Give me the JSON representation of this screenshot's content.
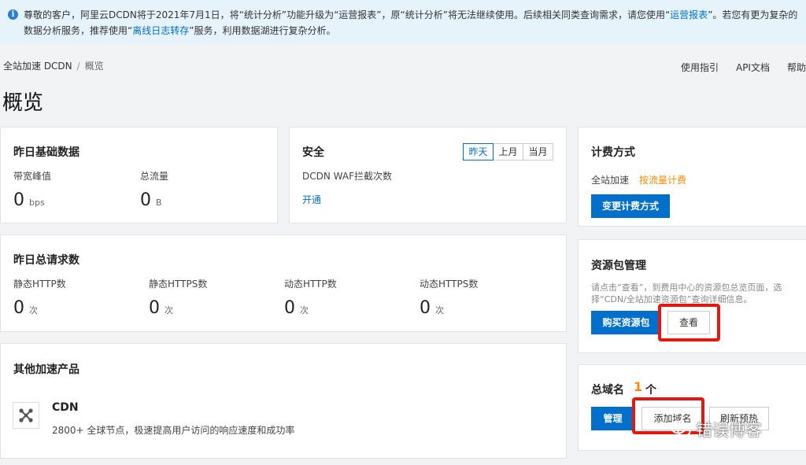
{
  "notice": {
    "part1": "尊敬的客户，阿里云DCDN将于2021年7月1日，将“统计分析”功能升级为“运营报表”，原“统计分析”将无法继续使用。后续相关同类查询需求，请您使用“",
    "link1": "运营报表",
    "part2": "”。若您有更为复杂的数据分析服务，推荐使用“",
    "link2": "离线日志转存",
    "part3": "”服务，利用数据湖进行复杂分析。"
  },
  "breadcrumb": {
    "root": "全站加速 DCDN",
    "sep": "/",
    "current": "概览"
  },
  "toplinks": {
    "guide": "使用指引",
    "api": "API文档",
    "help": "帮助"
  },
  "page_title": "概览",
  "basic": {
    "title": "昨日基础数据",
    "bandwidth_label": "带宽峰值",
    "bandwidth_value": "0",
    "bandwidth_unit": "bps",
    "traffic_label": "总流量",
    "traffic_value": "0",
    "traffic_unit": "B"
  },
  "security": {
    "title": "安全",
    "tabs": [
      "昨天",
      "上月",
      "当月"
    ],
    "waf_label": "DCDN WAF拦截次数",
    "enable_link": "开通"
  },
  "billing": {
    "title": "计费方式",
    "product": "全站加速",
    "method": "按流量计费",
    "change_button": "变更计费方式"
  },
  "requests": {
    "title": "昨日总请求数",
    "unit": "次",
    "items": [
      {
        "label": "静态HTTP数",
        "value": "0"
      },
      {
        "label": "静态HTTPS数",
        "value": "0"
      },
      {
        "label": "动态HTTP数",
        "value": "0"
      },
      {
        "label": "动态HTTPS数",
        "value": "0"
      }
    ]
  },
  "package": {
    "title": "资源包管理",
    "desc": "请点击“查看”，到费用中心的资源包总览页面，选择“CDN/全站加速资源包”查询详细信息。",
    "buy_button": "购买资源包",
    "view_button": "查看"
  },
  "other": {
    "title": "其他加速产品",
    "cdn_name": "CDN",
    "cdn_desc": "2800+ 全球节点，极速提高用户访问的响应速度和成功率"
  },
  "domains": {
    "title": "总域名",
    "count": "1",
    "unit": "个",
    "manage_button": "管理",
    "add_button": "添加域名",
    "refresh_button": "刷新预热"
  },
  "watermark": "错误博客",
  "colors": {
    "primary": "#0070cc",
    "accent": "#ff8a00",
    "highlight": "#e8170e"
  }
}
